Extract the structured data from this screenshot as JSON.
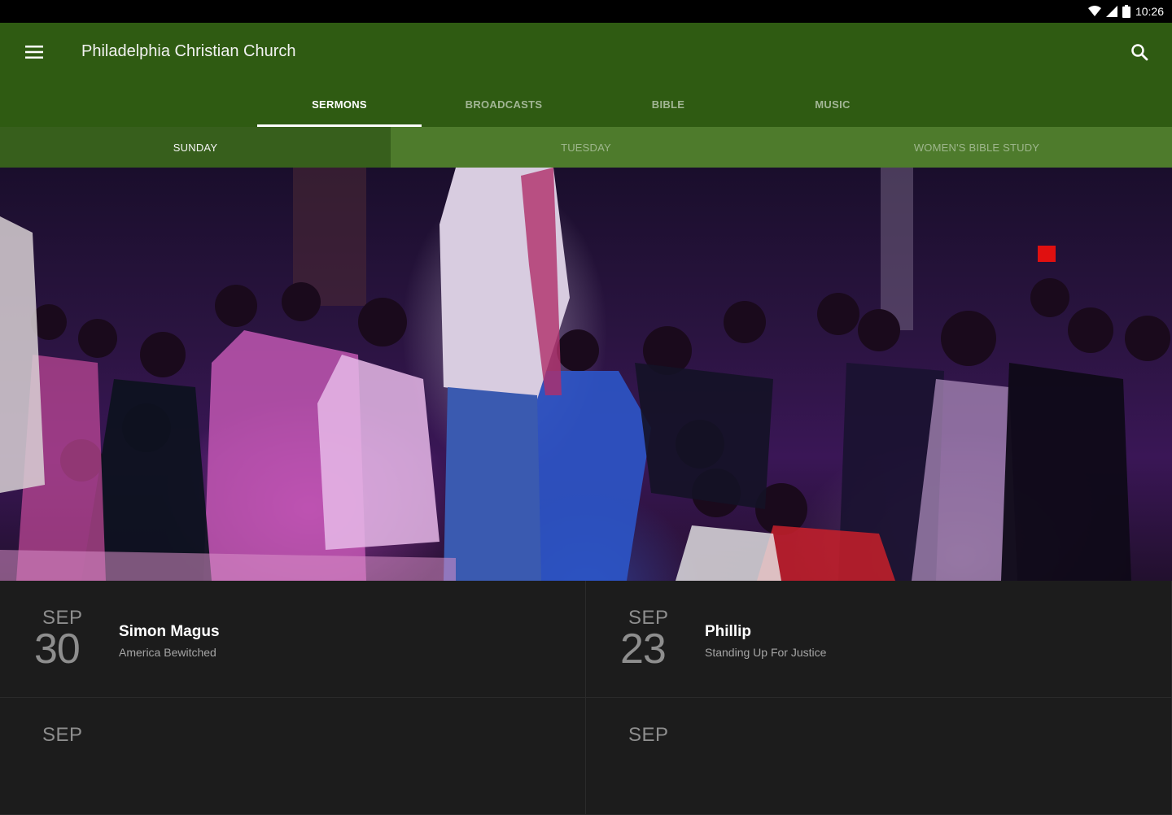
{
  "status_bar": {
    "time": "10:26"
  },
  "app_bar": {
    "title": "Philadelphia Christian Church"
  },
  "main_tabs": [
    {
      "label": "SERMONS",
      "active": true
    },
    {
      "label": "BROADCASTS",
      "active": false
    },
    {
      "label": "BIBLE",
      "active": false
    },
    {
      "label": "MUSIC",
      "active": false
    }
  ],
  "sub_tabs": [
    {
      "label": "SUNDAY",
      "active": true
    },
    {
      "label": "TUESDAY",
      "active": false
    },
    {
      "label": "WOMEN'S BIBLE STUDY",
      "active": false
    }
  ],
  "sermons": [
    {
      "month": "SEP",
      "day": "30",
      "title": "Simon Magus",
      "series": "America Bewitched"
    },
    {
      "month": "SEP",
      "day": "23",
      "title": "Phillip",
      "series": "Standing Up For Justice"
    },
    {
      "month": "SEP",
      "day": "",
      "title": "",
      "series": ""
    },
    {
      "month": "SEP",
      "day": "",
      "title": "",
      "series": ""
    }
  ],
  "colors": {
    "app_bar": "#2f5b12",
    "sub_tabs": "#4e7b2c",
    "sub_tab_active": "#375f1c",
    "list_bg": "#1c1c1c"
  }
}
